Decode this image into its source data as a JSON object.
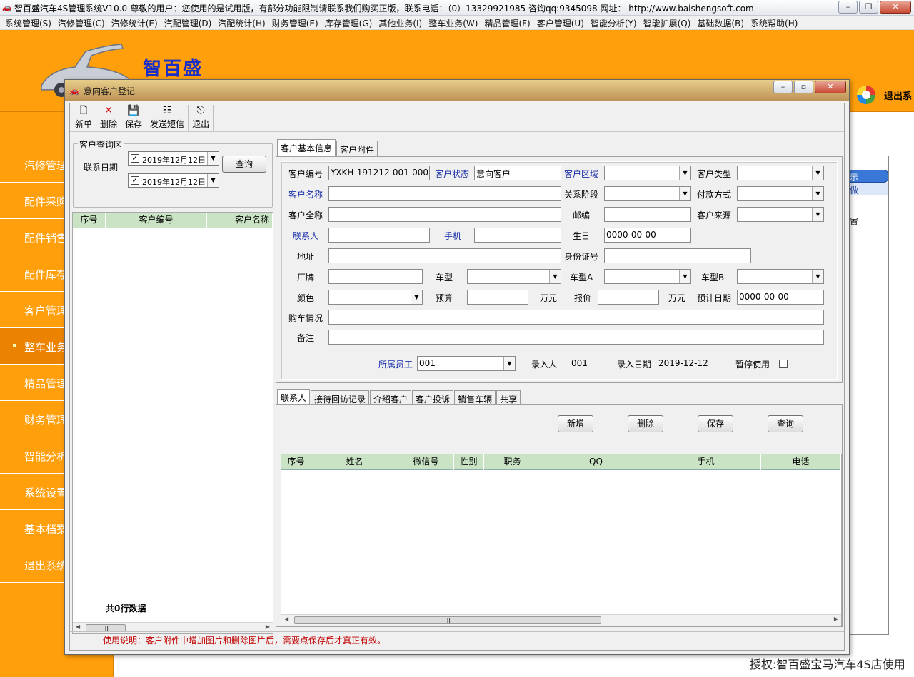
{
  "main_window": {
    "title": "智百盛汽车4S管理系统V10.0-尊敬的用户：您使用的是试用版，有部分功能限制请联系我们购买正版，联系电话：（0）13329921985 咨询qq:9345098  网址：  http://www.baishengsoft.com"
  },
  "menu": [
    "系统管理(S)",
    "汽修管理(C)",
    "汽修统计(E)",
    "汽配管理(D)",
    "汽配统计(H)",
    "财务管理(E)",
    "库存管理(G)",
    "其他业务(I)",
    "整车业务(W)",
    "精品管理(F)",
    "客户管理(U)",
    "智能分析(Y)",
    "智能扩展(Q)",
    "基础数据(B)",
    "系统帮助(H)"
  ],
  "brand": {
    "logo_text": "智百盛",
    "exit_label": "退出系"
  },
  "sidebar": {
    "items": [
      "汽修管理",
      "配件采购",
      "配件销售",
      "配件库存",
      "客户管理",
      "整车业务",
      "精品管理",
      "财务管理",
      "智能分析",
      "系统设置",
      "基本档案",
      "退出系统"
    ],
    "active_index": 5
  },
  "background_panel": {
    "char1": "示",
    "char2": "做",
    "char3": "置"
  },
  "license": "授权:智百盛宝马汽车4S店使用",
  "dialog": {
    "title": "意向客户登记",
    "toolbar": {
      "new_label": "新单",
      "delete_label": "删除",
      "save_label": "保存",
      "sms_label": "发送短信",
      "exit_label": "退出"
    },
    "query": {
      "legend": "客户查询区",
      "date_label": "联系日期",
      "date_from": "2019年12月12日",
      "date_to": "2019年12月12日",
      "query_button": "查询"
    },
    "left_list": {
      "columns": [
        "序号",
        "客户编号",
        "客户名称"
      ],
      "total_text": "共0行数据"
    },
    "top_tabs": [
      "客户基本信息",
      "客户附件"
    ],
    "form": {
      "customer_no_label": "客户编号",
      "customer_no": "YXKH-191212-001-0001",
      "status_label": "客户状态",
      "status": "意向客户",
      "region_label": "客户区域",
      "type_label": "客户类型",
      "name_label": "客户名称",
      "relation_label": "关系阶段",
      "payment_label": "付款方式",
      "fullname_label": "客户全称",
      "zip_label": "邮编",
      "source_label": "客户来源",
      "contact_label": "联系人",
      "mobile_label": "手机",
      "birthday_label": "生日",
      "birthday": "0000-00-00",
      "address_label": "地址",
      "idcard_label": "身份证号",
      "brand_label": "厂牌",
      "model_label": "车型",
      "model_a_label": "车型A",
      "model_b_label": "车型B",
      "color_label": "颜色",
      "budget_label": "预算",
      "unit1": "万元",
      "quote_label": "报价",
      "unit2": "万元",
      "expected_date_label": "预计日期",
      "expected_date": "0000-00-00",
      "purchase_label": "购车情况",
      "remark_label": "备注",
      "staff_label": "所属员工",
      "staff": "001",
      "entered_by_label": "录入人",
      "entered_by": "001",
      "entry_date_label": "录入日期",
      "entry_date": "2019-12-12",
      "pause_label": "暂停使用"
    },
    "bottom_tabs": [
      "联系人",
      "接待回访记录",
      "介绍客户",
      "客户投诉",
      "销售车辆",
      "共享"
    ],
    "bottom_buttons": {
      "add": "新增",
      "delete": "删除",
      "save": "保存",
      "query": "查询"
    },
    "contact_grid": {
      "columns": [
        "序号",
        "姓名",
        "微信号",
        "性别",
        "职务",
        "QQ",
        "手机",
        "电话"
      ]
    },
    "usage_note": "使用说明：客户附件中增加图片和删除图片后，需要点保存后才真正有效。"
  }
}
